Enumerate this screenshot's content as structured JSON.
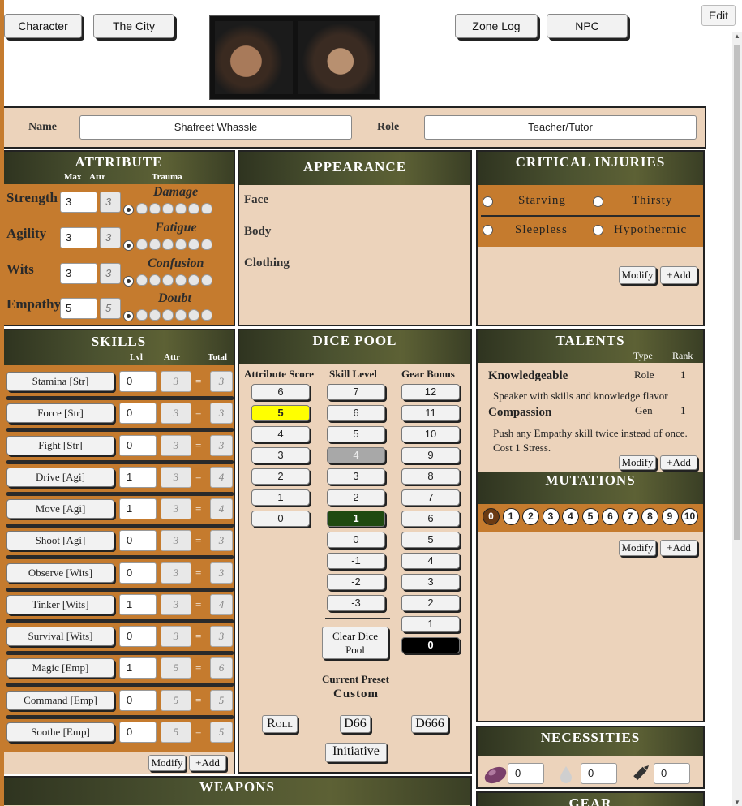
{
  "nav": {
    "character": "Character",
    "city": "The City",
    "zone_log": "Zone Log",
    "npc": "NPC",
    "edit": "Edit"
  },
  "identity": {
    "name_label": "Name",
    "name_value": "Shafreet Whassle",
    "role_label": "Role",
    "role_value": "Teacher/Tutor"
  },
  "attributes": {
    "title": "ATTRIBUTE",
    "col_max": "Max",
    "col_attr": "Attr",
    "col_trauma": "Trauma",
    "rows": [
      {
        "name": "Strength",
        "max": "3",
        "attr": "3",
        "trauma": "Damage"
      },
      {
        "name": "Agility",
        "max": "3",
        "attr": "3",
        "trauma": "Fatigue"
      },
      {
        "name": "Wits",
        "max": "3",
        "attr": "3",
        "trauma": "Confusion"
      },
      {
        "name": "Empathy",
        "max": "5",
        "attr": "5",
        "trauma": "Doubt"
      }
    ]
  },
  "appearance": {
    "title": "APPEARANCE",
    "face": "Face",
    "body": "Body",
    "clothing": "Clothing"
  },
  "critical_injuries": {
    "title": "CRITICAL INJURIES",
    "starving": "Starving",
    "thirsty": "Thirsty",
    "sleepless": "Sleepless",
    "hypothermic": "Hypothermic",
    "modify": "Modify",
    "add": "+Add"
  },
  "skills": {
    "title": "SKILLS",
    "col_lvl": "Lvl",
    "col_attr": "Attr",
    "col_total": "Total",
    "eq": "=",
    "rows": [
      {
        "label": "Stamina [Str]",
        "lvl": "0",
        "attr": "3",
        "total": "3"
      },
      {
        "label": "Force [Str]",
        "lvl": "0",
        "attr": "3",
        "total": "3"
      },
      {
        "label": "Fight [Str]",
        "lvl": "0",
        "attr": "3",
        "total": "3"
      },
      {
        "label": "Drive [Agi]",
        "lvl": "1",
        "attr": "3",
        "total": "4"
      },
      {
        "label": "Move [Agi]",
        "lvl": "1",
        "attr": "3",
        "total": "4"
      },
      {
        "label": "Shoot [Agi]",
        "lvl": "0",
        "attr": "3",
        "total": "3"
      },
      {
        "label": "Observe [Wits]",
        "lvl": "0",
        "attr": "3",
        "total": "3"
      },
      {
        "label": "Tinker [Wits]",
        "lvl": "1",
        "attr": "3",
        "total": "4"
      },
      {
        "label": "Survival [Wits]",
        "lvl": "0",
        "attr": "3",
        "total": "3"
      },
      {
        "label": "Magic [Emp]",
        "lvl": "1",
        "attr": "5",
        "total": "6"
      },
      {
        "label": "Command [Emp]",
        "lvl": "0",
        "attr": "5",
        "total": "5"
      },
      {
        "label": "Soothe [Emp]",
        "lvl": "0",
        "attr": "5",
        "total": "5"
      }
    ],
    "modify": "Modify",
    "add": "+Add"
  },
  "dice_pool": {
    "title": "DICE POOL",
    "col_attr": "Attribute Score",
    "col_skill": "Skill Level",
    "col_gear": "Gear Bonus",
    "attr_values": [
      "6",
      "5",
      "4",
      "3",
      "2",
      "1",
      "0"
    ],
    "attr_selected": "5",
    "skill_values": [
      "7",
      "6",
      "5",
      "4",
      "3",
      "2",
      "1",
      "0",
      "-1",
      "-2",
      "-3"
    ],
    "skill_disabled": "4",
    "skill_selected": "1",
    "gear_values": [
      "12",
      "11",
      "10",
      "9",
      "8",
      "7",
      "6",
      "5",
      "4",
      "3",
      "2",
      "1",
      "0"
    ],
    "gear_selected": "0",
    "clear": "Clear Dice Pool",
    "preset_label": "Current Preset",
    "preset_value": "Custom",
    "roll": "Roll",
    "d66": "D66",
    "d666": "D666",
    "initiative": "Initiative",
    "colors": {
      "attr_selected": "#ffff00",
      "skill_disabled": "#a8a8a8",
      "skill_selected": "#1f4a10",
      "gear_selected": "#000000"
    }
  },
  "talents": {
    "title": "TALENTS",
    "col_type": "Type",
    "col_rank": "Rank",
    "items": [
      {
        "name": "Knowledgeable",
        "type": "Role",
        "rank": "1",
        "desc": "Speaker with skills and knowledge flavor"
      },
      {
        "name": "Compassion",
        "type": "Gen",
        "rank": "1",
        "desc": "Push any Empathy skill twice instead of once. Cost 1 Stress."
      }
    ],
    "modify": "Modify",
    "add": "+Add"
  },
  "mutations": {
    "title": "MUTATIONS",
    "points": [
      "0",
      "1",
      "2",
      "3",
      "4",
      "5",
      "6",
      "7",
      "8",
      "9",
      "10"
    ],
    "selected": "0",
    "modify": "Modify",
    "add": "+Add"
  },
  "necessities": {
    "title": "NECESSITIES",
    "food": "0",
    "water": "0",
    "ammo": "0",
    "icons": [
      "food-icon",
      "water-drop-icon",
      "bullet-icon"
    ]
  },
  "weapons": {
    "title": "WEAPONS"
  },
  "gear": {
    "title": "GEAR"
  },
  "colors": {
    "accent": "#c57b2e",
    "panel": "#ecd3bb",
    "header": "#4b5230"
  }
}
